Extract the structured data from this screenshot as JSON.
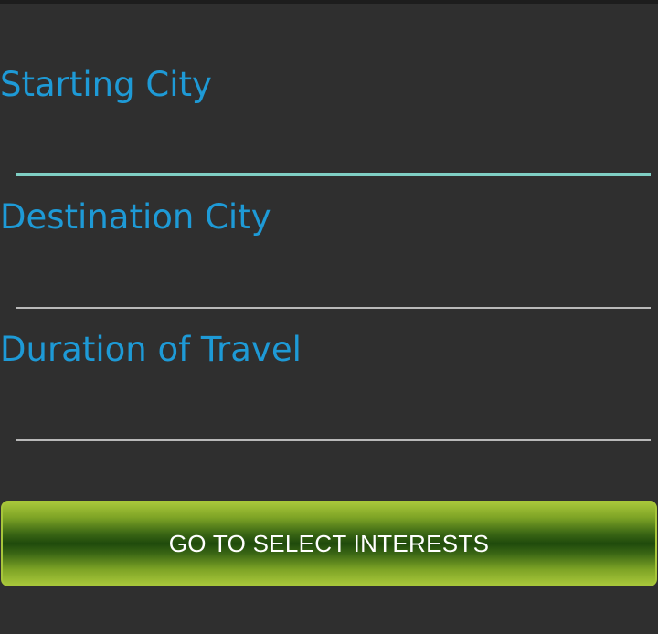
{
  "form": {
    "starting_city": {
      "label": "Starting City",
      "value": ""
    },
    "destination_city": {
      "label": "Destination City",
      "value": ""
    },
    "duration": {
      "label": "Duration of Travel",
      "value": ""
    }
  },
  "actions": {
    "submit_label": "GO TO SELECT INTERESTS"
  },
  "colors": {
    "background": "#2f2f2f",
    "label": "#1e9ad6",
    "focused_underline": "#7fcfc4",
    "underline": "#b9b9b9",
    "button_green_dark": "#1f4a0c",
    "button_green_light": "#a7c63a"
  }
}
